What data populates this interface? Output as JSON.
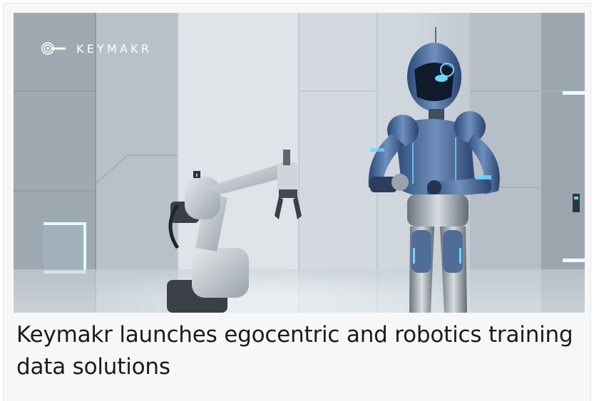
{
  "article": {
    "brand_logo_text": "KEYMAKR",
    "headline": "Keymakr launches egocentric and robotics training data solutions",
    "image_icon": "robot-lab-photo"
  },
  "colors": {
    "card_background": "#f7f7f7",
    "headline_text": "#1b1b1b",
    "accent_glow": "#6fd3ff"
  }
}
